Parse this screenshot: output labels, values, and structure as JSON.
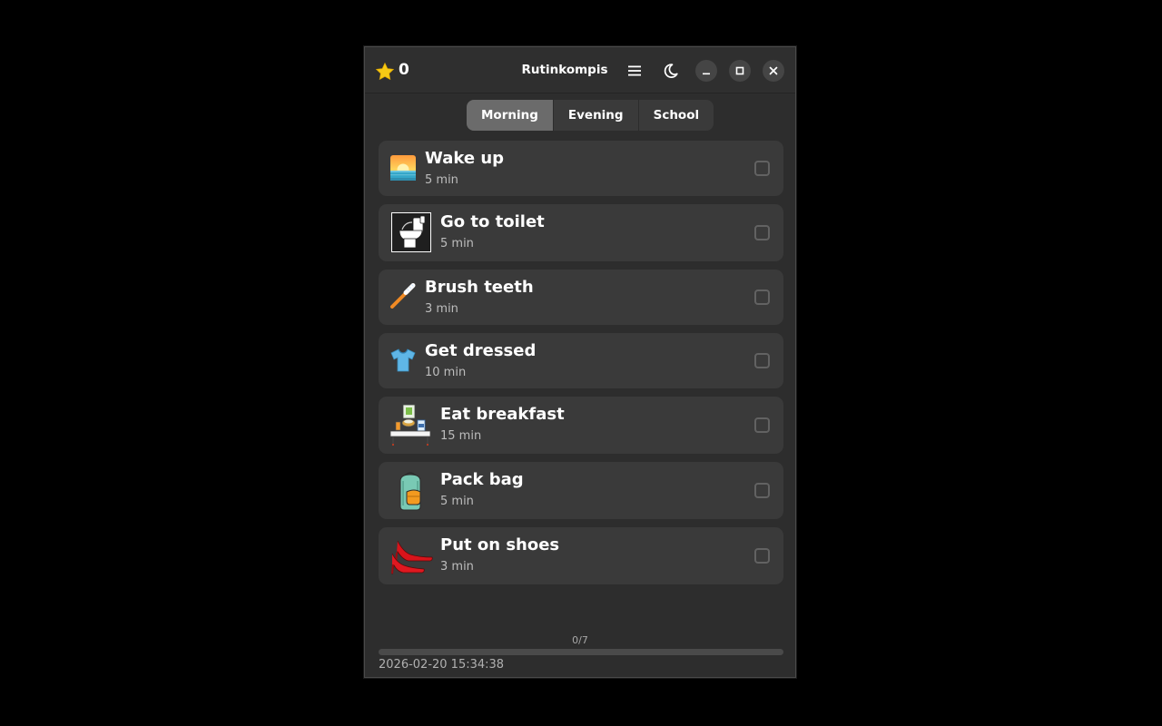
{
  "header": {
    "score": "0",
    "title": "Rutinkompis"
  },
  "tabs": [
    {
      "label": "Morning",
      "active": true
    },
    {
      "label": "Evening",
      "active": false
    },
    {
      "label": "School",
      "active": false
    }
  ],
  "tasks": [
    {
      "name": "Wake up",
      "duration": "5 min",
      "icon": "sunrise-icon",
      "done": false
    },
    {
      "name": "Go to toilet",
      "duration": "5 min",
      "icon": "toilet-icon",
      "done": false
    },
    {
      "name": "Brush teeth",
      "duration": "3 min",
      "icon": "toothbrush-icon",
      "done": false
    },
    {
      "name": "Get dressed",
      "duration": "10 min",
      "icon": "tshirt-icon",
      "done": false
    },
    {
      "name": "Eat breakfast",
      "duration": "15 min",
      "icon": "breakfast-icon",
      "done": false
    },
    {
      "name": "Pack bag",
      "duration": "5 min",
      "icon": "backpack-icon",
      "done": false
    },
    {
      "name": "Put on shoes",
      "duration": "3 min",
      "icon": "shoes-icon",
      "done": false
    }
  ],
  "progress": {
    "label": "0/7",
    "fraction": 0
  },
  "footer": {
    "timestamp": "2026-02-20 15:34:38"
  },
  "colors": {
    "background": "#000000",
    "window": "#2d2d2d",
    "card": "#3a3a3a",
    "tab_active": "#6b6b6b",
    "star": "#f6c915"
  }
}
